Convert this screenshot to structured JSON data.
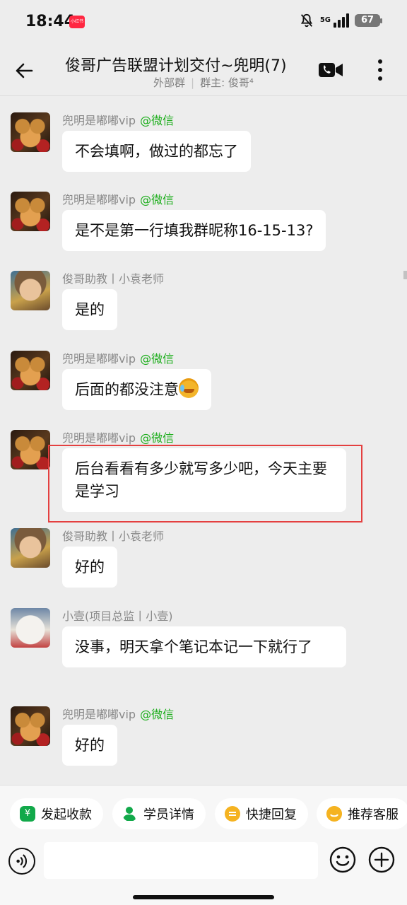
{
  "status_bar": {
    "time": "18:44",
    "app_badge": "小红书",
    "network": "5G",
    "battery": "67"
  },
  "header": {
    "title": "俊哥广告联盟计划交付~兜明(7)",
    "subtitle_type": "外部群",
    "subtitle_owner": "群主: 俊哥⁴"
  },
  "messages": [
    {
      "sender": "兜明是嘟嘟vip",
      "tag": "@微信",
      "avatar": "tiger-avatar",
      "text": "不会填啊，做过的都忘了"
    },
    {
      "sender": "兜明是嘟嘟vip",
      "tag": "@微信",
      "avatar": "tiger-avatar",
      "text": "是不是第一行填我群昵称16-15-13?"
    },
    {
      "sender": "俊哥助教丨小袁老师",
      "tag": "",
      "avatar": "girl-avatar",
      "text": "是的"
    },
    {
      "sender": "兜明是嘟嘟vip",
      "tag": "@微信",
      "avatar": "tiger-avatar",
      "text": "后面的都没注意",
      "emoji": "crying-face-emoji"
    },
    {
      "sender": "兜明是嘟嘟vip",
      "tag": "@微信",
      "avatar": "tiger-avatar",
      "text": "后台看看有多少就写多少吧，今天主要是学习"
    },
    {
      "sender": "俊哥助教丨小袁老师",
      "tag": "",
      "avatar": "girl-avatar",
      "text": "好的"
    },
    {
      "sender": "小壹(项目总监丨小壹)",
      "tag": "",
      "avatar": "bear-avatar",
      "text": "没事，明天拿个笔记本记一下就行了"
    },
    {
      "sender": "兜明是嘟嘟vip",
      "tag": "@微信",
      "avatar": "tiger-avatar",
      "text": "好的"
    }
  ],
  "quick_actions": [
    {
      "label": "发起收款",
      "icon": "yen-icon"
    },
    {
      "label": "学员详情",
      "icon": "user-icon"
    },
    {
      "label": "快捷回复",
      "icon": "reply-icon"
    },
    {
      "label": "推荐客服",
      "icon": "service-icon"
    }
  ],
  "icons": {
    "back": "arrow-left-icon",
    "video": "video-call-icon",
    "more": "more-vertical-icon",
    "voice": "voice-icon",
    "emoji": "emoji-icon",
    "plus": "plus-icon"
  },
  "colors": {
    "accent_green": "#1aad19",
    "highlight_red": "#e44040",
    "background": "#ededed"
  }
}
